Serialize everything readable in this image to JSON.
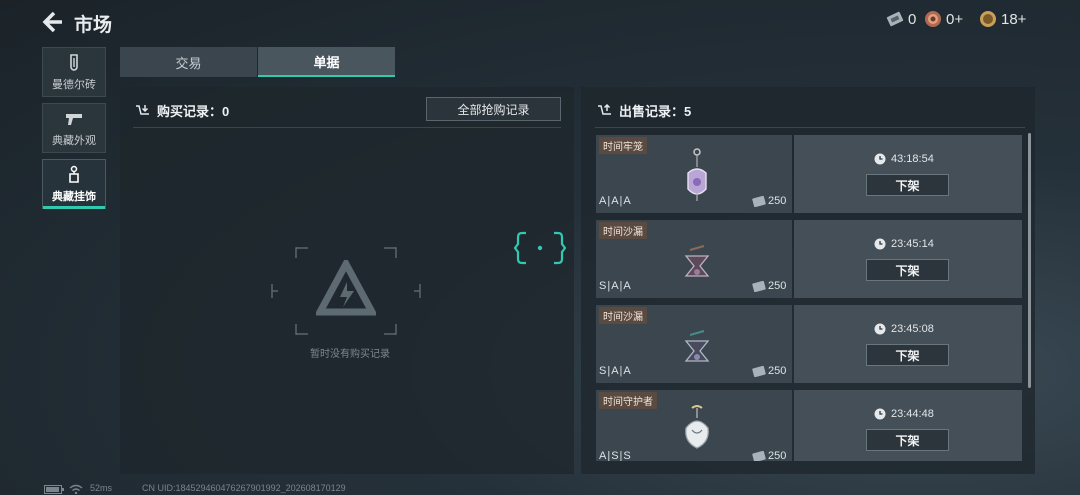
{
  "header": {
    "title": "市场",
    "currencies": [
      {
        "icon": "ticket-icon",
        "value": "0"
      },
      {
        "icon": "medal-icon",
        "value": "0+"
      },
      {
        "icon": "coin-icon",
        "value": "18+"
      }
    ]
  },
  "sidebar": {
    "items": [
      {
        "label": "曼德尔砖",
        "icon": "brick-icon",
        "active": false
      },
      {
        "label": "典藏外观",
        "icon": "pistol-icon",
        "active": false
      },
      {
        "label": "典藏挂饰",
        "icon": "charm-icon",
        "active": true
      }
    ]
  },
  "tabs": [
    {
      "label": "交易",
      "active": false
    },
    {
      "label": "单据",
      "active": true
    }
  ],
  "buy_panel": {
    "title": "购买记录：0",
    "all_button": "全部抢购记录",
    "empty_text": "暂时没有购买记录"
  },
  "sell_panel": {
    "title": "出售记录：5",
    "records": [
      {
        "tag": "时间牢笼",
        "grade": "A|A|A",
        "price": "250",
        "time": "43:18:54",
        "button": "下架"
      },
      {
        "tag": "时间沙漏",
        "grade": "S|A|A",
        "price": "250",
        "time": "23:45:14",
        "button": "下架"
      },
      {
        "tag": "时间沙漏",
        "grade": "S|A|A",
        "price": "250",
        "time": "23:45:08",
        "button": "下架"
      },
      {
        "tag": "时间守护者",
        "grade": "A|S|S",
        "price": "250",
        "time": "23:44:48",
        "button": "下架"
      }
    ]
  },
  "footer": {
    "ping": "52ms",
    "uid": "CN UID:1845294604762679019​92_202608170129"
  },
  "colors": {
    "accent": "#31c9b0",
    "tag_bg": "#5a4a40"
  }
}
